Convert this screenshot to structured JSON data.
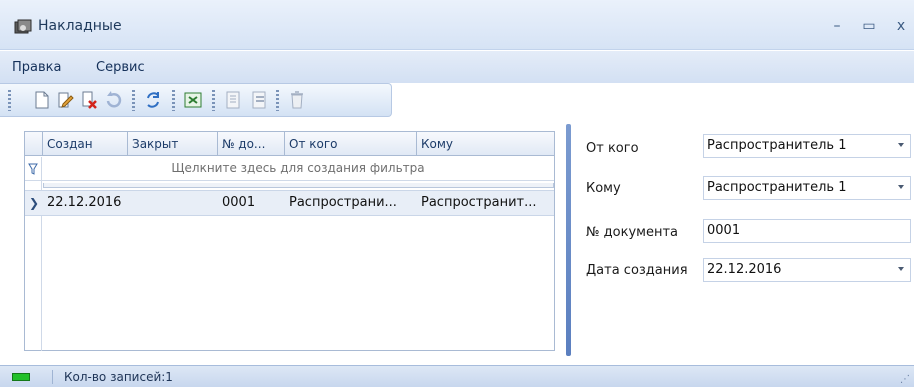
{
  "window": {
    "title": "Накладные",
    "icon": "app-document-icon",
    "controls": {
      "minimize": "–",
      "maximize": "▭",
      "close": "x"
    }
  },
  "menu": {
    "items": [
      "Правка",
      "Сервис"
    ]
  },
  "toolbar": {
    "buttons": [
      "new-icon",
      "edit-icon",
      "delete-icon",
      "undo-icon",
      "refresh-icon",
      "excel-icon",
      "group-icon",
      "ungroup-icon",
      "trash-icon"
    ]
  },
  "grid": {
    "columns": [
      "Создан",
      "Закрыт",
      "№ до...",
      "От кого",
      "Кому"
    ],
    "filter_hint": "Щелкните здесь для создания фильтра",
    "rows": [
      {
        "created": "22.12.2016",
        "closed": "",
        "doc_no": "0001",
        "from": "Распространи...",
        "to": "Распространит..."
      }
    ]
  },
  "form": {
    "from_label": "От кого",
    "from_value": "Распространитель 1",
    "to_label": "Кому",
    "to_value": "Распространитель 1",
    "doc_label": "№ документа",
    "doc_value": "0001",
    "date_label": "Дата создания",
    "date_value": "22.12.2016"
  },
  "status": {
    "records": "Кол-во записей:1"
  },
  "colors": {
    "accent": "#5b7fbf",
    "status_led": "#22c02a",
    "title_text": "#1e395b"
  }
}
